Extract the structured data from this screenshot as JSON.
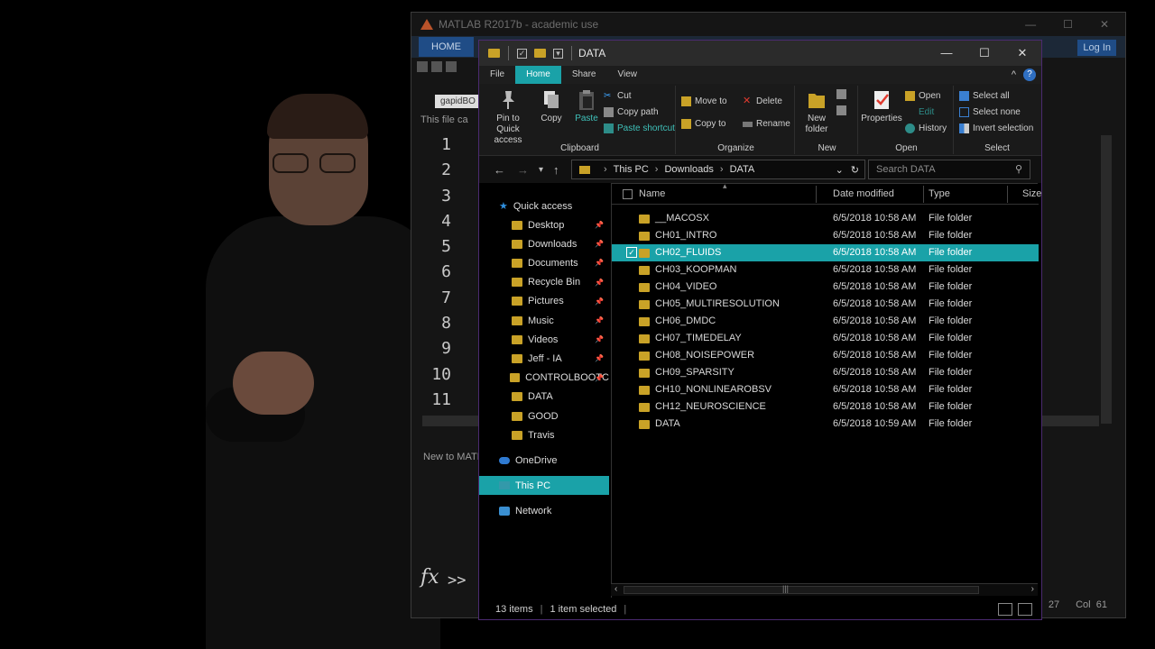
{
  "matlab": {
    "title": "MATLAB R2017b - academic use",
    "home_tab": "HOME",
    "login": "Log In",
    "doc_tab": "gapidBO",
    "info_text": "This file ca",
    "line_numbers": [
      "1",
      "2",
      "3",
      "4",
      "5",
      "6",
      "7",
      "8",
      "9",
      "10",
      "11"
    ],
    "new_to_matlab": "New to MATL",
    "fx": "fx",
    "prompt": ">>",
    "cursor_row": "27",
    "cursor_col_label": "Col",
    "cursor_col": "61"
  },
  "explorer": {
    "title": "DATA",
    "window_controls": {
      "minimize": "—",
      "maximize": "☐",
      "close": "✕"
    },
    "menu_tabs": [
      "File",
      "Home",
      "Share",
      "View"
    ],
    "active_tab": "Home",
    "ribbon": {
      "clipboard": {
        "label": "Clipboard",
        "pin": "Pin to Quick access",
        "copy": "Copy",
        "paste": "Paste",
        "cut": "Cut",
        "copy_path": "Copy path",
        "paste_shortcut": "Paste shortcut"
      },
      "organize": {
        "label": "Organize",
        "move_to": "Move to",
        "copy_to": "Copy to",
        "delete": "Delete",
        "rename": "Rename"
      },
      "new": {
        "label": "New",
        "new_folder": "New folder"
      },
      "open": {
        "label": "Open",
        "properties": "Properties",
        "open": "Open",
        "edit": "Edit",
        "history": "History"
      },
      "select": {
        "label": "Select",
        "select_all": "Select all",
        "select_none": "Select none",
        "invert": "Invert selection"
      }
    },
    "address": {
      "crumbs": [
        "This PC",
        "Downloads",
        "DATA"
      ],
      "search_placeholder": "Search DATA"
    },
    "nav": {
      "quick_access": "Quick access",
      "items": [
        {
          "label": "Desktop",
          "pinned": true
        },
        {
          "label": "Downloads",
          "pinned": true
        },
        {
          "label": "Documents",
          "pinned": true
        },
        {
          "label": "Recycle Bin",
          "pinned": true
        },
        {
          "label": "Pictures",
          "pinned": true
        },
        {
          "label": "Music",
          "pinned": true
        },
        {
          "label": "Videos",
          "pinned": true
        },
        {
          "label": "Jeff - IA",
          "pinned": true
        },
        {
          "label": "CONTROLBOOTC",
          "pinned": true
        },
        {
          "label": "DATA",
          "pinned": false
        },
        {
          "label": "GOOD",
          "pinned": false
        },
        {
          "label": "Travis",
          "pinned": false
        }
      ],
      "onedrive": "OneDrive",
      "this_pc": "This PC",
      "network": "Network"
    },
    "columns": {
      "name": "Name",
      "date": "Date modified",
      "type": "Type",
      "size": "Size"
    },
    "files": [
      {
        "name": "__MACOSX",
        "date": "6/5/2018 10:58 AM",
        "type": "File folder"
      },
      {
        "name": "CH01_INTRO",
        "date": "6/5/2018 10:58 AM",
        "type": "File folder"
      },
      {
        "name": "CH02_FLUIDS",
        "date": "6/5/2018 10:58 AM",
        "type": "File folder"
      },
      {
        "name": "CH03_KOOPMAN",
        "date": "6/5/2018 10:58 AM",
        "type": "File folder"
      },
      {
        "name": "CH04_VIDEO",
        "date": "6/5/2018 10:58 AM",
        "type": "File folder"
      },
      {
        "name": "CH05_MULTIRESOLUTION",
        "date": "6/5/2018 10:58 AM",
        "type": "File folder"
      },
      {
        "name": "CH06_DMDC",
        "date": "6/5/2018 10:58 AM",
        "type": "File folder"
      },
      {
        "name": "CH07_TIMEDELAY",
        "date": "6/5/2018 10:58 AM",
        "type": "File folder"
      },
      {
        "name": "CH08_NOISEPOWER",
        "date": "6/5/2018 10:58 AM",
        "type": "File folder"
      },
      {
        "name": "CH09_SPARSITY",
        "date": "6/5/2018 10:58 AM",
        "type": "File folder"
      },
      {
        "name": "CH10_NONLINEAROBSV",
        "date": "6/5/2018 10:58 AM",
        "type": "File folder"
      },
      {
        "name": "CH12_NEUROSCIENCE",
        "date": "6/5/2018 10:58 AM",
        "type": "File folder"
      },
      {
        "name": "DATA",
        "date": "6/5/2018 10:59 AM",
        "type": "File folder"
      }
    ],
    "selected_file": "CH02_FLUIDS",
    "status": {
      "items": "13 items",
      "selected": "1 item selected"
    },
    "colors": {
      "accent": "#1aa2a8",
      "folder": "#c9a227",
      "border": "#4b2a70"
    }
  }
}
